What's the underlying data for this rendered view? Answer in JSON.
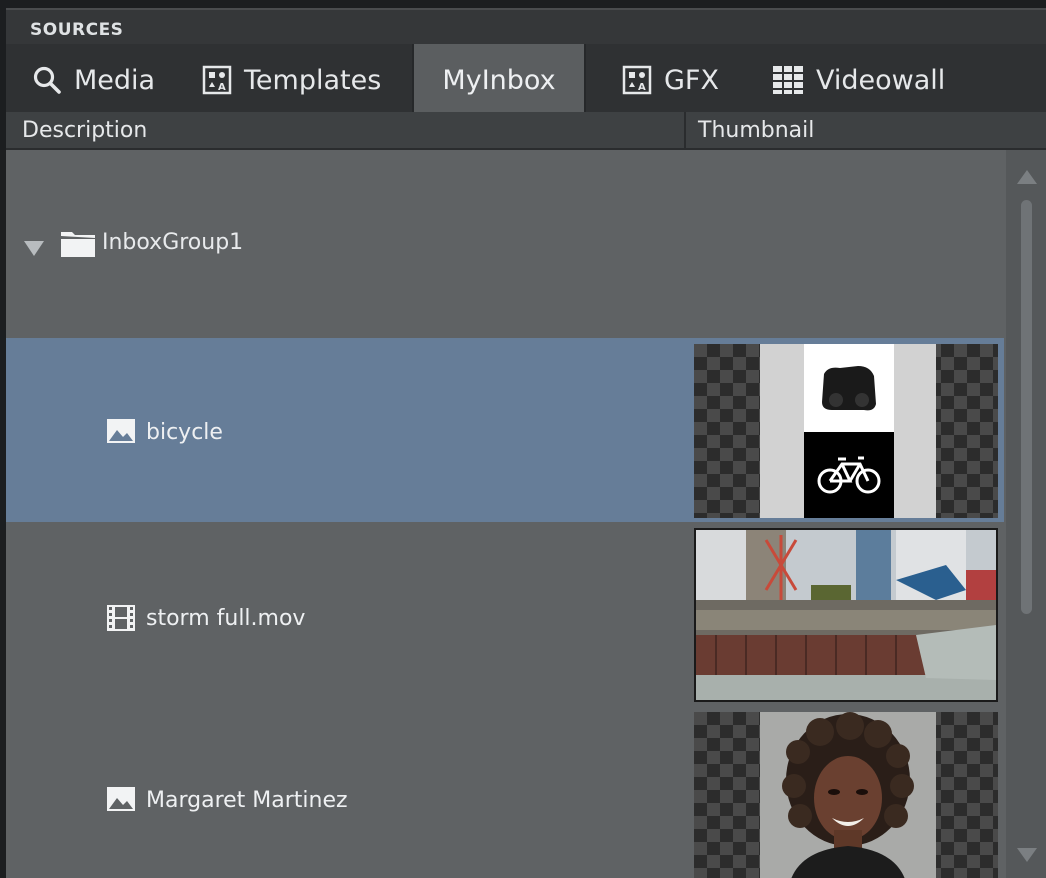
{
  "panel": {
    "title": "SOURCES"
  },
  "tabs": [
    {
      "label": "Media",
      "icon": "search-icon"
    },
    {
      "label": "Templates",
      "icon": "template-icon"
    },
    {
      "label": "MyInbox",
      "icon": "",
      "active": true
    },
    {
      "label": "GFX",
      "icon": "template-icon"
    },
    {
      "label": "Videowall",
      "icon": "grid-icon"
    }
  ],
  "columns": {
    "description": "Description",
    "thumbnail": "Thumbnail"
  },
  "tree": {
    "group": {
      "label": "InboxGroup1",
      "icon": "folder-icon",
      "expanded": true
    },
    "items": [
      {
        "label": "bicycle",
        "icon": "image-icon",
        "selected": true,
        "thumbnail": "bicycle-graphic"
      },
      {
        "label": "storm full.mov",
        "icon": "film-icon",
        "selected": false,
        "thumbnail": "construction-site-photo"
      },
      {
        "label": "Margaret Martinez",
        "icon": "image-icon",
        "selected": false,
        "thumbnail": "portrait-photo"
      }
    ]
  },
  "colors": {
    "selection": "#667d98",
    "panel": "#5f6264",
    "tabbar": "#2f3133"
  }
}
